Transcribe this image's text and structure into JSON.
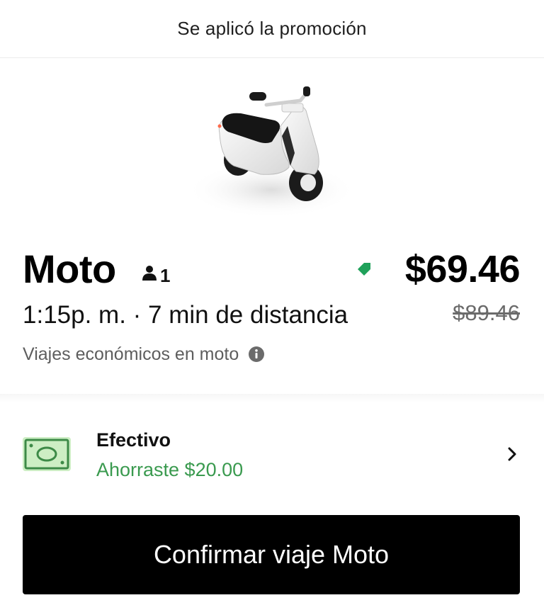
{
  "banner": {
    "text": "Se aplicó la promoción"
  },
  "product": {
    "image_icon": "scooter-illustration",
    "name": "Moto",
    "capacity_icon": "person-icon",
    "capacity": "1",
    "price": "$69.46",
    "promo_icon": "tag-icon",
    "original_price": "$89.46",
    "eta": "1:15p. m. · 7 min de distancia",
    "description": "Viajes económicos en moto",
    "info_icon": "info-icon"
  },
  "payment": {
    "icon": "cash-icon",
    "method": "Efectivo",
    "savings": "Ahorraste $20.00",
    "chevron_icon": "chevron-right-icon"
  },
  "confirm": {
    "label": "Confirmar viaje Moto"
  },
  "colors": {
    "promo_green": "#1fa15a",
    "savings_green": "#3a9a4f",
    "cash_icon_bg": "#cdeec4",
    "button_bg": "#000000"
  }
}
